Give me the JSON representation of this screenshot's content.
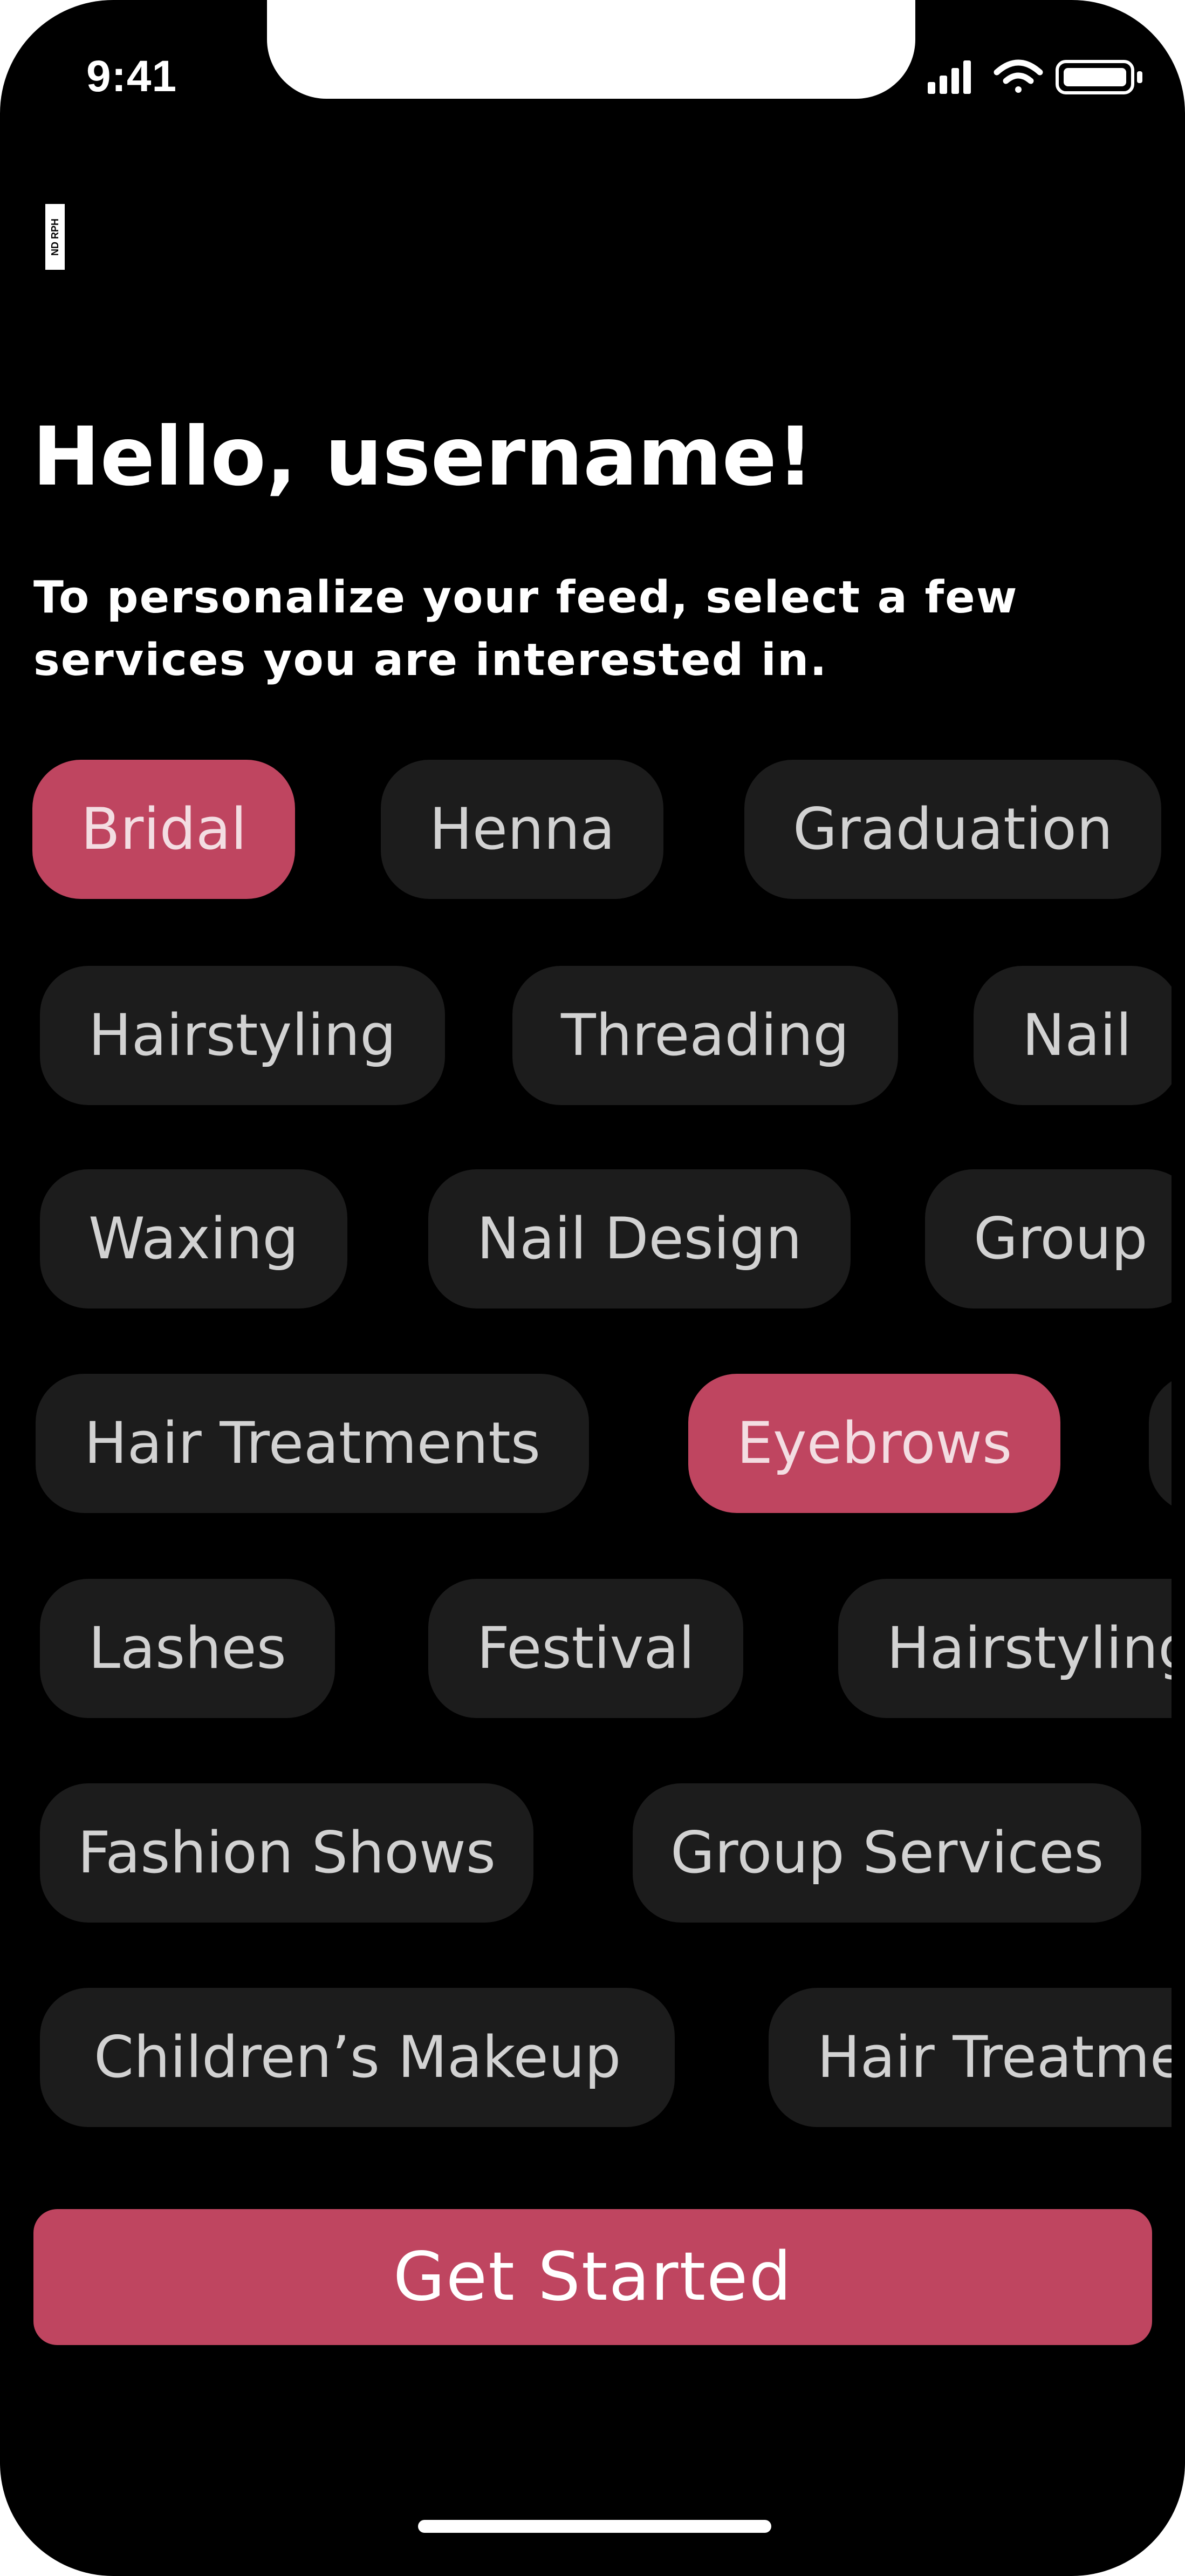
{
  "status_bar": {
    "time": "9:41",
    "icons": [
      "signal-icon",
      "wifi-icon",
      "battery-icon"
    ]
  },
  "logo": {
    "text": "ND RPH"
  },
  "header": {
    "greeting": "Hello, username!",
    "subtitle": "To personalize your feed, select a few services you are interested in."
  },
  "services": [
    {
      "label": "Bridal",
      "selected": true
    },
    {
      "label": "Henna",
      "selected": false
    },
    {
      "label": "Graduation",
      "selected": false
    },
    {
      "label": "Hairstyling",
      "selected": false
    },
    {
      "label": "Threading",
      "selected": false
    },
    {
      "label": "Nail",
      "selected": false
    },
    {
      "label": "Waxing",
      "selected": false
    },
    {
      "label": "Nail Design",
      "selected": false
    },
    {
      "label": "Group",
      "selected": false
    },
    {
      "label": "Hair Treatments",
      "selected": false
    },
    {
      "label": "Eyebrows",
      "selected": true
    },
    {
      "label": "",
      "selected": false
    },
    {
      "label": "Lashes",
      "selected": false
    },
    {
      "label": "Festival",
      "selected": false
    },
    {
      "label": "Hairstyling",
      "selected": false
    },
    {
      "label": "Fashion Shows",
      "selected": false
    },
    {
      "label": "Group Services",
      "selected": false
    },
    {
      "label": "Children’s Makeup",
      "selected": false
    },
    {
      "label": "Hair Treatments",
      "selected": false
    }
  ],
  "cta": {
    "label": "Get Started"
  },
  "colors": {
    "accent": "#bf4560",
    "chip_bg": "#1c1c1c",
    "background": "#000000"
  }
}
